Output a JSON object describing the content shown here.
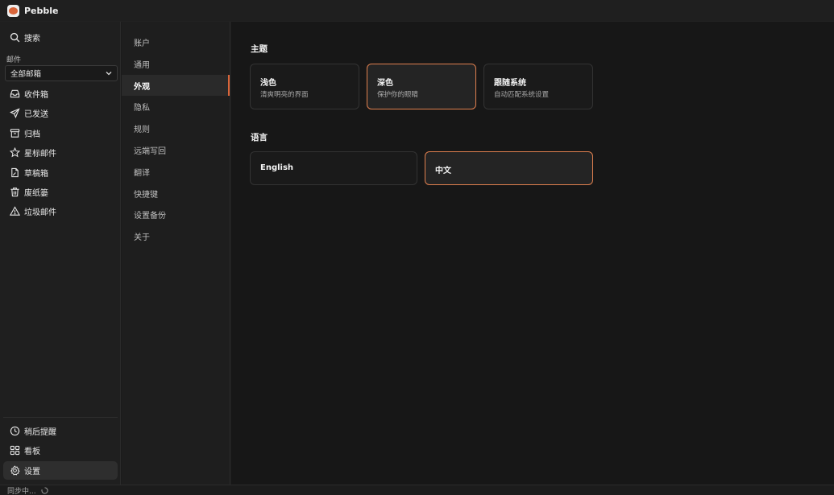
{
  "app": {
    "title": "Pebble"
  },
  "sidebar": {
    "search_label": "搜索",
    "section_label": "邮件",
    "mailbox_select": {
      "value": "全部邮箱"
    },
    "folders": [
      {
        "key": "inbox",
        "label": "收件箱",
        "icon": "inbox-icon"
      },
      {
        "key": "sent",
        "label": "已发送",
        "icon": "send-icon"
      },
      {
        "key": "archive",
        "label": "归档",
        "icon": "archive-icon"
      },
      {
        "key": "starred",
        "label": "星标邮件",
        "icon": "star-icon"
      },
      {
        "key": "drafts",
        "label": "草稿箱",
        "icon": "draft-icon"
      },
      {
        "key": "trash",
        "label": "废纸篓",
        "icon": "trash-icon"
      },
      {
        "key": "spam",
        "label": "垃圾邮件",
        "icon": "warning-icon"
      }
    ],
    "bottom": [
      {
        "key": "snoozed",
        "label": "稍后提醒",
        "icon": "clock-icon"
      },
      {
        "key": "board",
        "label": "看板",
        "icon": "grid-icon"
      },
      {
        "key": "settings",
        "label": "设置",
        "icon": "gear-icon",
        "active": true
      }
    ]
  },
  "status": {
    "text": "同步中..."
  },
  "settings_nav": {
    "items": [
      {
        "label": "账户"
      },
      {
        "label": "通用"
      },
      {
        "label": "外观",
        "active": true
      },
      {
        "label": "隐私"
      },
      {
        "label": "规则"
      },
      {
        "label": "远端写回"
      },
      {
        "label": "翻译"
      },
      {
        "label": "快捷键"
      },
      {
        "label": "设置备份"
      },
      {
        "label": "关于"
      }
    ]
  },
  "appearance": {
    "theme_title": "主题",
    "themes": [
      {
        "title": "浅色",
        "desc": "清爽明亮的界面",
        "selected": false
      },
      {
        "title": "深色",
        "desc": "保护你的眼睛",
        "selected": true
      },
      {
        "title": "跟随系统",
        "desc": "自动匹配系统设置",
        "selected": false
      }
    ],
    "language_title": "语言",
    "languages": [
      {
        "title": "English",
        "selected": false
      },
      {
        "title": "中文",
        "selected": true
      }
    ]
  },
  "colors": {
    "accent": "#e0804f",
    "background": "#171717",
    "sidebar": "#1f1f1f"
  }
}
